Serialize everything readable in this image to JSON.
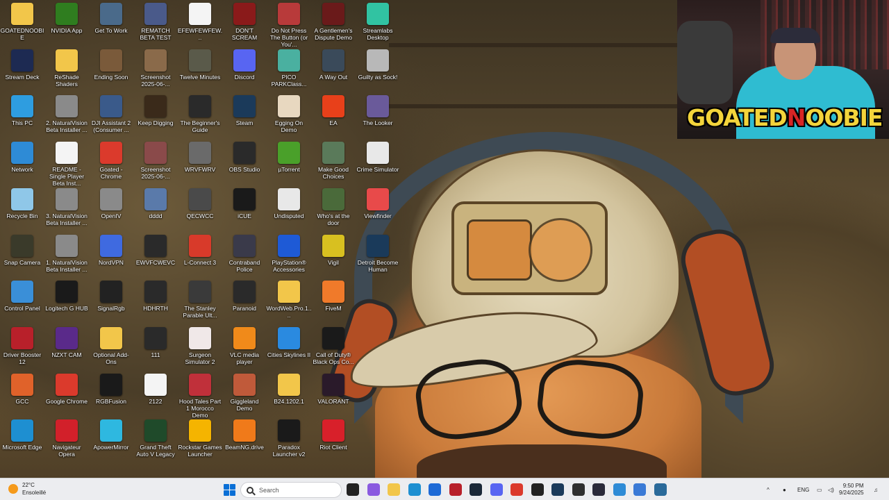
{
  "desktop": {
    "columns": [
      [
        {
          "label": "GOATEDNOOBIE",
          "icon": "folder-icon",
          "color": "#f2c64a"
        },
        {
          "label": "Stream Deck",
          "icon": "stream-deck-icon",
          "color": "#1d2a52"
        },
        {
          "label": "This PC",
          "icon": "monitor-icon",
          "color": "#2e9de0"
        },
        {
          "label": "Network",
          "icon": "network-icon",
          "color": "#2e8bd6"
        },
        {
          "label": "Recycle Bin",
          "icon": "recycle-bin-icon",
          "color": "#8fc7e8"
        },
        {
          "label": "Snap Camera",
          "icon": "snap-camera-icon",
          "color": "#3a3a2a"
        },
        {
          "label": "Control Panel",
          "icon": "control-panel-icon",
          "color": "#3a8fd8"
        },
        {
          "label": "Driver Booster 12",
          "icon": "driver-booster-icon",
          "color": "#b8202a"
        },
        {
          "label": "GCC",
          "icon": "gcc-icon",
          "color": "#e0622a"
        },
        {
          "label": "Microsoft Edge",
          "icon": "edge-icon",
          "color": "#1e8fd1"
        }
      ],
      [
        {
          "label": "NVIDIA App",
          "icon": "nvidia-icon",
          "color": "#2f7d1f"
        },
        {
          "label": "ReShade Shaders",
          "icon": "folder-icon",
          "color": "#f2c64a"
        },
        {
          "label": "2. NaturalVision Beta Installer ...",
          "icon": "naturalvision-icon",
          "color": "#8a8a8a"
        },
        {
          "label": "README - Single Player Beta Inst...",
          "icon": "chrome-doc-icon",
          "color": "#f4f4f4"
        },
        {
          "label": "3. NaturalVision Beta Installer ...",
          "icon": "naturalvision-icon",
          "color": "#8a8a8a"
        },
        {
          "label": "1. NaturalVision Beta Installer ...",
          "icon": "naturalvision-icon",
          "color": "#8a8a8a"
        },
        {
          "label": "Logitech G HUB",
          "icon": "logitech-icon",
          "color": "#1a1a1a"
        },
        {
          "label": "NZXT CAM",
          "icon": "nzxt-icon",
          "color": "#5a2a8a"
        },
        {
          "label": "Google Chrome",
          "icon": "chrome-icon",
          "color": "#db3a2c"
        },
        {
          "label": "Navigateur Opera",
          "icon": "opera-icon",
          "color": "#d2202a"
        }
      ],
      [
        {
          "label": "Get To Work",
          "icon": "game-icon",
          "color": "#4a6a8a"
        },
        {
          "label": "Ending Soon",
          "icon": "video-file-icon",
          "color": "#7a5a3a"
        },
        {
          "label": "DJI Assistant 2 (Consumer ...",
          "icon": "dji-icon",
          "color": "#3a5a8a"
        },
        {
          "label": "Goated - Chrome",
          "icon": "chrome-icon",
          "color": "#db3a2c"
        },
        {
          "label": "OpenIV",
          "icon": "openiv-icon",
          "color": "#8a8a8a"
        },
        {
          "label": "NordVPN",
          "icon": "nordvpn-icon",
          "color": "#3f6ae0"
        },
        {
          "label": "SignalRgb",
          "icon": "signalrgb-icon",
          "color": "#222"
        },
        {
          "label": "Optional Add-Ons",
          "icon": "folder-icon",
          "color": "#f2c64a"
        },
        {
          "label": "RGBFusion",
          "icon": "rgbfusion-icon",
          "color": "#1a1a1a"
        },
        {
          "label": "ApowerMirror",
          "icon": "apowermirror-icon",
          "color": "#2eb8e0"
        }
      ],
      [
        {
          "label": "REMATCH BETA TEST",
          "icon": "game-icon",
          "color": "#4a5a8a"
        },
        {
          "label": "Screenshot 2025-06-...",
          "icon": "image-file-icon",
          "color": "#8a6a4a"
        },
        {
          "label": "Keep Digging",
          "icon": "pickaxe-icon",
          "color": "#3a2a1a"
        },
        {
          "label": "Screenshot 2025-06-...",
          "icon": "image-file-icon",
          "color": "#8a4a4a"
        },
        {
          "label": "dddd",
          "icon": "image-file-icon",
          "color": "#5a7aaa"
        },
        {
          "label": "EWVFCWEVC",
          "icon": "blank-file-icon",
          "color": "#2a2a2a"
        },
        {
          "label": "HDHRTH",
          "icon": "blank-file-icon",
          "color": "#2a2a2a"
        },
        {
          "label": "111",
          "icon": "blank-file-icon",
          "color": "#2a2a2a"
        },
        {
          "label": "2122",
          "icon": "blank-file-icon",
          "color": "#f4f4f4"
        },
        {
          "label": "Grand Theft Auto V Legacy",
          "icon": "gta-icon",
          "color": "#1f4a2a"
        }
      ],
      [
        {
          "label": "EFEWFEWFEW...",
          "icon": "blank-file-icon",
          "color": "#f4f4f4"
        },
        {
          "label": "Twelve Minutes",
          "icon": "game-icon",
          "color": "#5a5a4a"
        },
        {
          "label": "The Beginner's Guide",
          "icon": "game-icon",
          "color": "#2a2a2a"
        },
        {
          "label": "WRVFWRV",
          "icon": "blank-file-icon",
          "color": "#6a6a6a"
        },
        {
          "label": "QECWCC",
          "icon": "blank-file-icon",
          "color": "#4a4a4a"
        },
        {
          "label": "L-Connect 3",
          "icon": "lconnect-icon",
          "color": "#d83a2a"
        },
        {
          "label": "The Stanley Parable Ult...",
          "icon": "game-icon",
          "color": "#3a3a3a"
        },
        {
          "label": "Surgeon Simulator 2",
          "icon": "game-icon",
          "color": "#f0e8e8"
        },
        {
          "label": "Hood Tales Part 1 Morocco Demo",
          "icon": "game-icon",
          "color": "#c0303a"
        },
        {
          "label": "Rockstar Games Launcher",
          "icon": "rockstar-icon",
          "color": "#f5b400"
        }
      ],
      [
        {
          "label": "DON'T SCREAM",
          "icon": "game-icon",
          "color": "#8a1a1a"
        },
        {
          "label": "Discord",
          "icon": "discord-icon",
          "color": "#5865f2"
        },
        {
          "label": "Steam",
          "icon": "steam-icon",
          "color": "#1b3a5a"
        },
        {
          "label": "OBS Studio",
          "icon": "obs-icon",
          "color": "#2a2a2a"
        },
        {
          "label": "iCUE",
          "icon": "icue-icon",
          "color": "#1a1a1a"
        },
        {
          "label": "Contraband Police",
          "icon": "game-icon",
          "color": "#3a3a4a"
        },
        {
          "label": "Paranoid",
          "icon": "game-icon",
          "color": "#2a2a2a"
        },
        {
          "label": "VLC media player",
          "icon": "vlc-icon",
          "color": "#f08a1a"
        },
        {
          "label": "Giggleland Demo",
          "icon": "game-icon",
          "color": "#c05a3a"
        },
        {
          "label": "BeamNG.drive",
          "icon": "beamng-icon",
          "color": "#f07a1a"
        }
      ],
      [
        {
          "label": "Do Not Press The Button (or You'...",
          "icon": "game-icon",
          "color": "#b83a3a"
        },
        {
          "label": "PICO PARKClass...",
          "icon": "game-icon",
          "color": "#4ab0a0"
        },
        {
          "label": "Egging On Demo",
          "icon": "egg-icon",
          "color": "#e8d8c0"
        },
        {
          "label": "µTorrent",
          "icon": "utorrent-icon",
          "color": "#4aa02a"
        },
        {
          "label": "Undisputed",
          "icon": "game-icon",
          "color": "#e8e8e8"
        },
        {
          "label": "PlayStation® Accessories",
          "icon": "playstation-icon",
          "color": "#1e5ad6"
        },
        {
          "label": "WordWeb.Pro.1....",
          "icon": "folder-icon",
          "color": "#f2c64a"
        },
        {
          "label": "Cities Skylines II",
          "icon": "cities-icon",
          "color": "#2a8ae0"
        },
        {
          "label": "B24.1202.1",
          "icon": "folder-icon",
          "color": "#f2c64a"
        },
        {
          "label": "Paradox Launcher v2",
          "icon": "paradox-icon",
          "color": "#1a1a1a"
        }
      ],
      [
        {
          "label": "A Gentlemen's Dispute Demo",
          "icon": "game-icon",
          "color": "#6a1a1a"
        },
        {
          "label": "A Way Out",
          "icon": "game-icon",
          "color": "#3a4a5a"
        },
        {
          "label": "EA",
          "icon": "ea-icon",
          "color": "#e8401a"
        },
        {
          "label": "Make Good Choices",
          "icon": "game-icon",
          "color": "#5a7a5a"
        },
        {
          "label": "Who's at the door",
          "icon": "game-icon",
          "color": "#4a6a3a"
        },
        {
          "label": "Vigil",
          "icon": "game-icon",
          "color": "#d8c020"
        },
        {
          "label": "FiveM",
          "icon": "fivem-icon",
          "color": "#f07a2a"
        },
        {
          "label": "Call of Duty® Black Ops Co...",
          "icon": "game-icon",
          "color": "#1a1a1a"
        },
        {
          "label": "VALORANT",
          "icon": "valorant-icon",
          "color": "#2a1a2a"
        },
        {
          "label": "Riot Client",
          "icon": "riot-icon",
          "color": "#d8202a"
        }
      ],
      [
        {
          "label": "Streamlabs Desktop",
          "icon": "streamlabs-icon",
          "color": "#31c3a2"
        },
        {
          "label": "Guilty as Sock!",
          "icon": "game-icon",
          "color": "#b8b8b8"
        },
        {
          "label": "The Looker",
          "icon": "game-icon",
          "color": "#6a5a9a"
        },
        {
          "label": "Crime Simulator",
          "icon": "game-icon",
          "color": "#e8e8e8"
        },
        {
          "label": "Viewfinder",
          "icon": "game-icon",
          "color": "#e84a4a"
        },
        {
          "label": "Detroit Become Human",
          "icon": "game-icon",
          "color": "#1a3a5a"
        }
      ]
    ]
  },
  "overlay": {
    "logo_part1": "GOATED",
    "logo_part2": "NOOBIE",
    "logo_color": "#f3d43b",
    "logo_accent": "#d62525"
  },
  "taskbar": {
    "weather_temp": "22°C",
    "weather_desc": "Ensoleillé",
    "search_placeholder": "Search",
    "language": "ENG",
    "time": "9:50 PM",
    "date": "9/24/2025",
    "apps": [
      {
        "name": "task-view-icon",
        "color": "#222"
      },
      {
        "name": "copilot-icon",
        "color": "#8a5ae0"
      },
      {
        "name": "file-explorer-icon",
        "color": "#f2c64a"
      },
      {
        "name": "edge-icon",
        "color": "#1e8fd1"
      },
      {
        "name": "store-icon",
        "color": "#1e6ad6"
      },
      {
        "name": "record-icon",
        "color": "#b8202a"
      },
      {
        "name": "steam-icon",
        "color": "#1b2838"
      },
      {
        "name": "discord-icon",
        "color": "#5865f2"
      },
      {
        "name": "chrome-icon",
        "color": "#db3a2c"
      },
      {
        "name": "obs-icon",
        "color": "#222"
      },
      {
        "name": "steam-icon",
        "color": "#1b3a5a"
      },
      {
        "name": "nvidia-icon",
        "color": "#2f2f2f"
      },
      {
        "name": "controller-icon",
        "color": "#2a2a3a"
      },
      {
        "name": "notepad-icon",
        "color": "#2e8bd6"
      },
      {
        "name": "snipping-icon",
        "color": "#3a7ad6"
      },
      {
        "name": "window-icon",
        "color": "#2a6a9a"
      }
    ]
  }
}
